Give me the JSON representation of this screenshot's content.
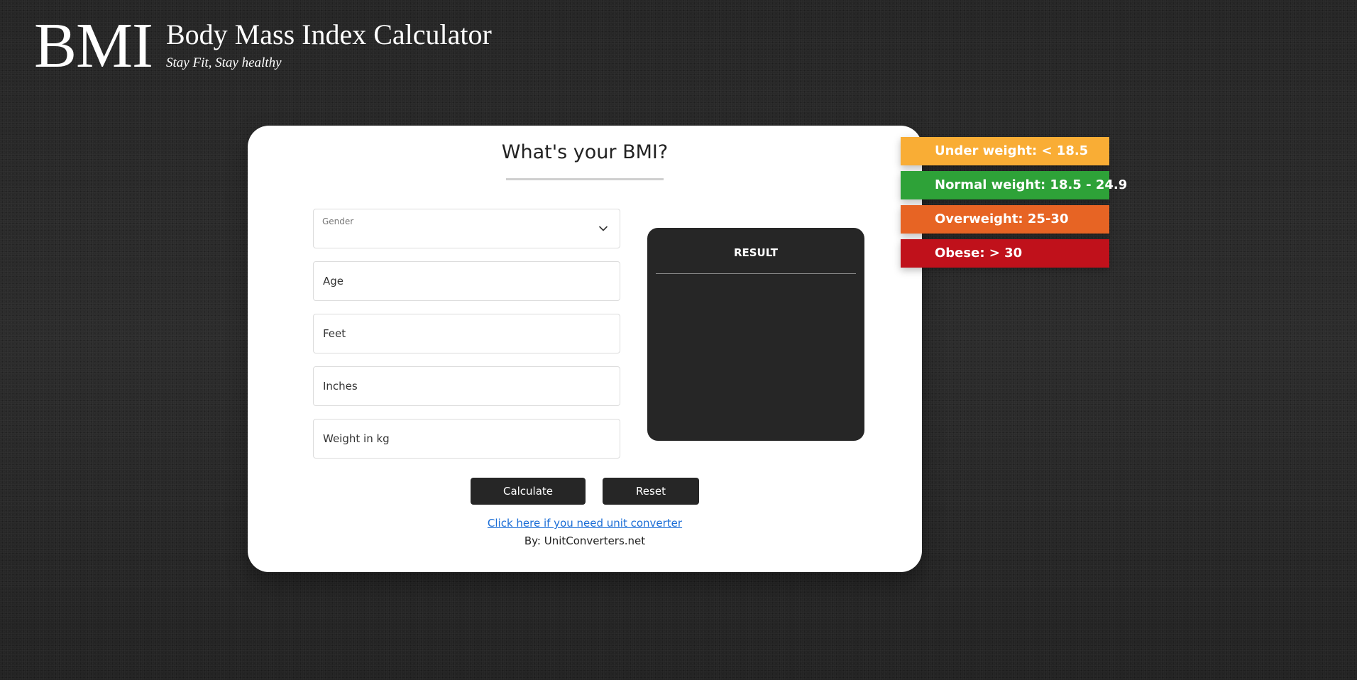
{
  "header": {
    "logo_text": "BMI",
    "title": "Body Mass Index Calculator",
    "tagline": "Stay Fit, Stay healthy"
  },
  "form": {
    "heading": "What's your BMI?",
    "gender": {
      "label": "Gender",
      "value": "",
      "icon": "chevron-down-icon"
    },
    "age_placeholder": "Age",
    "feet_placeholder": "Feet",
    "inches_placeholder": "Inches",
    "weight_placeholder": "Weight in kg",
    "calculate_label": "Calculate",
    "reset_label": "Reset",
    "converter_link": "Click here if you need unit converter",
    "credit": "By: UnitConverters.net"
  },
  "result": {
    "title": "RESULT",
    "value": ""
  },
  "legend": [
    {
      "label": "Under weight: < 18.5",
      "color": "#f9ad35"
    },
    {
      "label": "Normal weight: 18.5 - 24.9",
      "color": "#2ea238"
    },
    {
      "label": "Overweight: 25-30",
      "color": "#e76424"
    },
    {
      "label": "Obese: > 30",
      "color": "#c0111b"
    }
  ]
}
